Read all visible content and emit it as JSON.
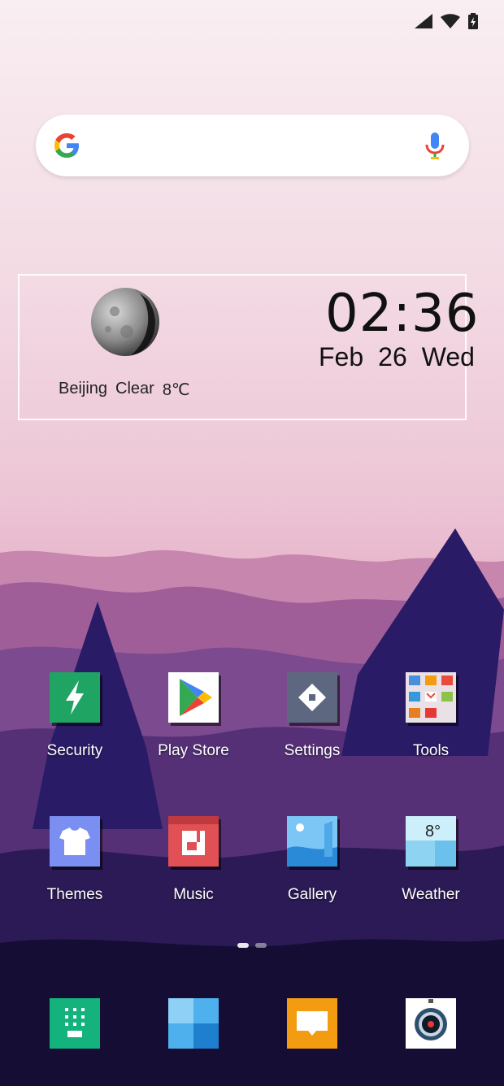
{
  "status_bar": {
    "icons": [
      "cell-signal-icon",
      "wifi-icon",
      "battery-charging-icon"
    ]
  },
  "search_bar": {
    "icons": [
      "google-g-icon",
      "microphone-icon"
    ]
  },
  "clock_widget": {
    "city": "Beijing",
    "condition": "Clear",
    "temperature": "8℃",
    "time": "02:36",
    "month": "Feb",
    "day": "26",
    "weekday": "Wed"
  },
  "apps_row1": [
    {
      "label": "Security",
      "icon": "security-bolt-icon",
      "color": "#1fa463"
    },
    {
      "label": "Play Store",
      "icon": "play-store-icon",
      "color": "#ffffff"
    },
    {
      "label": "Settings",
      "icon": "settings-gear-icon",
      "color": "#5d6780"
    },
    {
      "label": "Tools",
      "icon": "tools-folder-icon",
      "color": "#e9e1e6"
    }
  ],
  "apps_row2": [
    {
      "label": "Themes",
      "icon": "themes-shirt-icon",
      "color": "#7b8ef2"
    },
    {
      "label": "Music",
      "icon": "music-icon",
      "color": "#e05055"
    },
    {
      "label": "Gallery",
      "icon": "gallery-icon",
      "color": "#4fa8e8"
    },
    {
      "label": "Weather",
      "icon": "weather-icon",
      "color": "#9fdcf6",
      "badge": "8°"
    }
  ],
  "page_indicator": {
    "pages": 2,
    "current": 1
  },
  "dock": [
    {
      "icon": "phone-dialpad-icon",
      "color": "#14b37d"
    },
    {
      "icon": "contacts-tiles-icon",
      "color": "#2d8fd8"
    },
    {
      "icon": "messages-icon",
      "color": "#f39c12"
    },
    {
      "icon": "camera-icon",
      "color": "#ffffff"
    }
  ]
}
